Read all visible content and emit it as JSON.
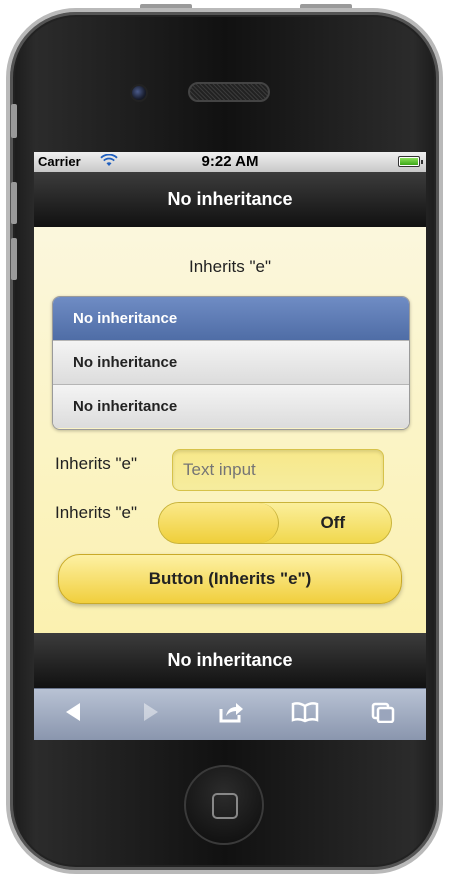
{
  "status_bar": {
    "carrier": "Carrier",
    "time": "9:22 AM"
  },
  "header": {
    "title": "No inheritance"
  },
  "content": {
    "heading": "Inherits \"e\"",
    "list_items": [
      "No inheritance",
      "No inheritance",
      "No inheritance"
    ],
    "text_field": {
      "label": "Inherits \"e\"",
      "placeholder": "Text input",
      "value": ""
    },
    "toggle": {
      "label": "Inherits \"e\"",
      "state": "Off"
    },
    "button_label": "Button (Inherits \"e\")"
  },
  "footer": {
    "title": "No inheritance"
  },
  "browser_toolbar": {
    "icons": [
      "back-icon",
      "forward-icon",
      "share-icon",
      "bookmarks-icon",
      "tabs-icon"
    ]
  },
  "colors": {
    "theme_background": "#fbf3c0",
    "list_active": "#5b79b3",
    "button_yellow": "#f3d54a"
  }
}
